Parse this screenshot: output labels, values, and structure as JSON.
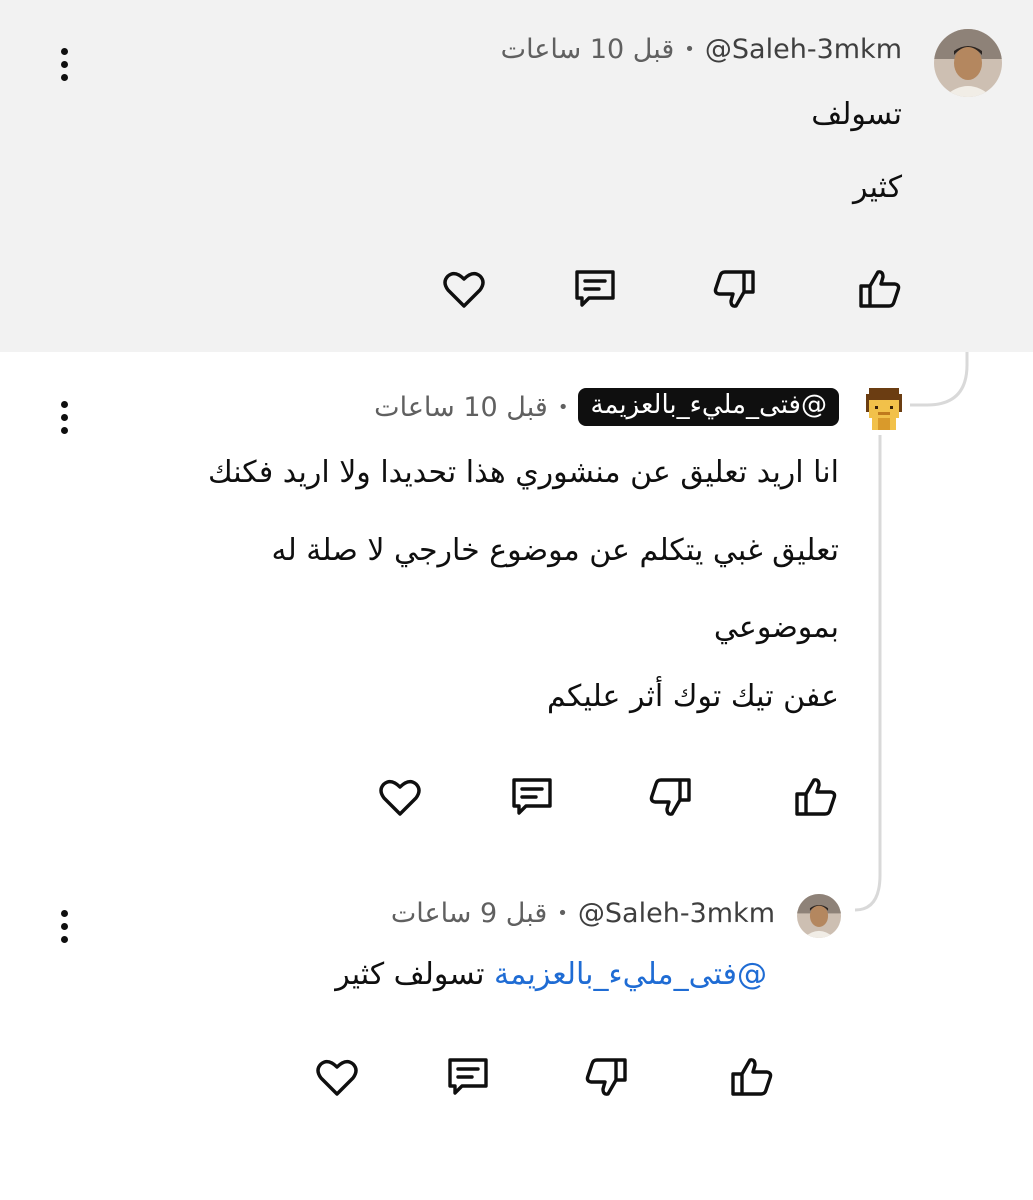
{
  "comments": [
    {
      "author": "@Saleh-3mkm",
      "separator": "•",
      "time": "قبل 10 ساعات",
      "lines": [
        "تسولف",
        "كثير"
      ]
    },
    {
      "author": "@فتى_مليء_بالعزيمة",
      "separator": "•",
      "time": "قبل 10 ساعات",
      "lines": [
        "انا اريد تعليق عن منشوري هذا تحديدا ولا اريد فكنك",
        "تعليق غبي يتكلم عن موضوع خارجي لا صلة له",
        "بموضوعي",
        "عفن تيك توك أثر عليكم"
      ]
    },
    {
      "author": "@Saleh-3mkm",
      "separator": "•",
      "time": "قبل 9 ساعات",
      "mention": "@فتى_مليء_بالعزيمة",
      "text": "تسولف كثير"
    }
  ],
  "icons": {
    "like": "thumbs-up-icon",
    "dislike": "thumbs-down-icon",
    "reply": "reply-icon",
    "heart": "heart-icon",
    "more": "more-vertical-icon"
  },
  "colors": {
    "highlight_bg": "#f2f2f2",
    "mention": "#1f6cd4",
    "badge_bg": "#0f0f0f",
    "thread_line": "#d9d9d9"
  }
}
